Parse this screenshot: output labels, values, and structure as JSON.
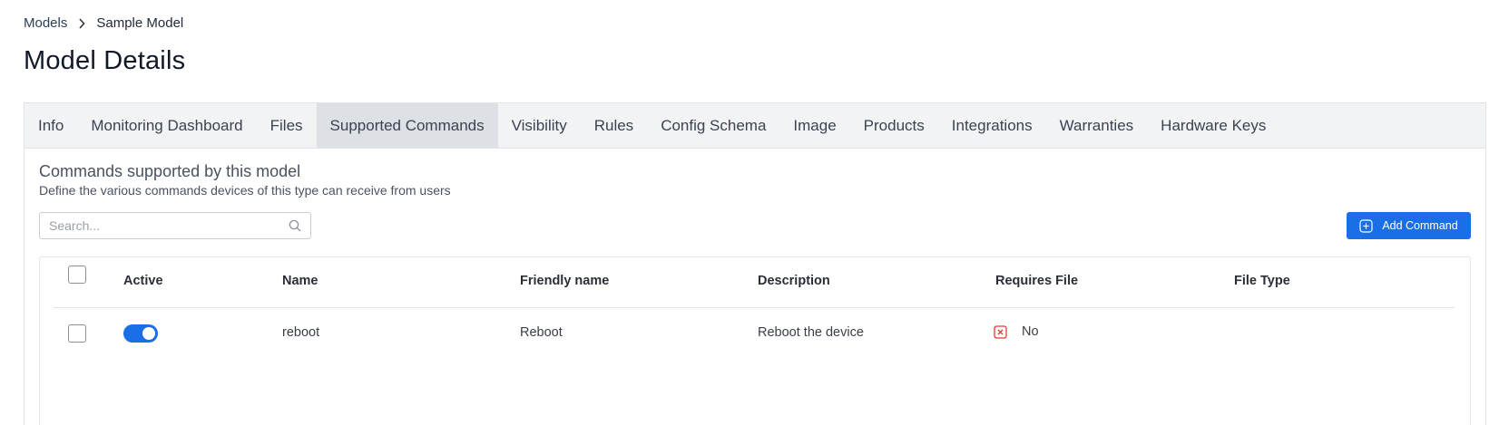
{
  "breadcrumb": {
    "parent": "Models",
    "current": "Sample Model"
  },
  "page": {
    "title": "Model Details"
  },
  "tabs": [
    {
      "label": "Info",
      "active": false
    },
    {
      "label": "Monitoring Dashboard",
      "active": false
    },
    {
      "label": "Files",
      "active": false
    },
    {
      "label": "Supported Commands",
      "active": true
    },
    {
      "label": "Visibility",
      "active": false
    },
    {
      "label": "Rules",
      "active": false
    },
    {
      "label": "Config Schema",
      "active": false
    },
    {
      "label": "Image",
      "active": false
    },
    {
      "label": "Products",
      "active": false
    },
    {
      "label": "Integrations",
      "active": false
    },
    {
      "label": "Warranties",
      "active": false
    },
    {
      "label": "Hardware Keys",
      "active": false
    }
  ],
  "section": {
    "title": "Commands supported by this model",
    "subtitle": "Define the various commands devices of this type can receive from users"
  },
  "search": {
    "placeholder": "Search...",
    "value": ""
  },
  "add_button": {
    "label": "Add Command",
    "icon": "plus-square-icon"
  },
  "table": {
    "columns": [
      "Active",
      "Name",
      "Friendly name",
      "Description",
      "Requires File",
      "File Type"
    ],
    "rows": [
      {
        "active": true,
        "name": "reboot",
        "friendly_name": "Reboot",
        "description": "Reboot the device",
        "requires_file": "No",
        "file_type": ""
      }
    ]
  },
  "colors": {
    "accent": "#1a6fe6",
    "danger": "#e53935",
    "tab_bar": "#f2f3f5",
    "tab_active": "#dde0e5"
  }
}
